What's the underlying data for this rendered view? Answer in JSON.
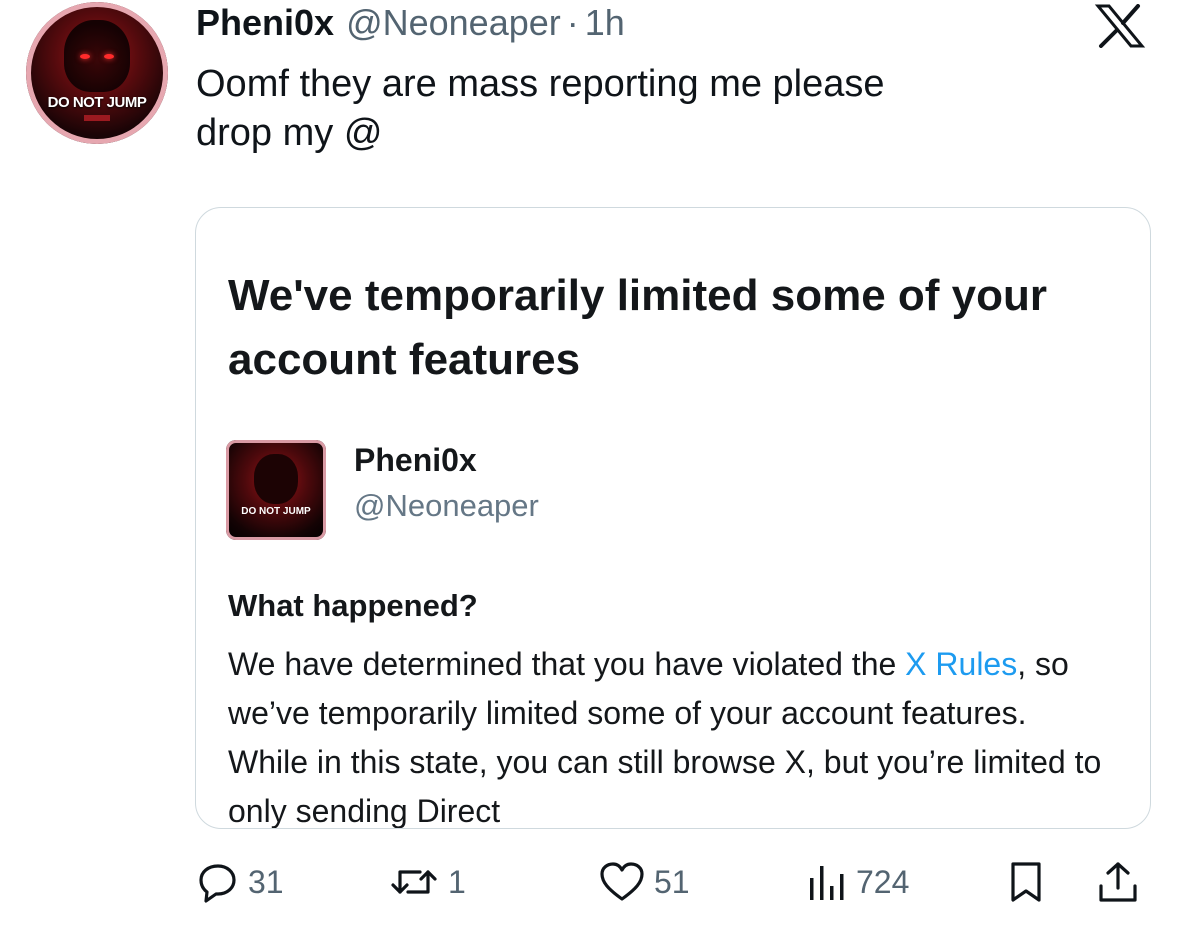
{
  "tweet": {
    "display_name": "Pheni0x",
    "handle": "@Neoneaper",
    "separator": "·",
    "time": "1h",
    "text_line1": "Oomf they are mass reporting me please",
    "text_line2": "drop my @",
    "avatar_text": "DO NOT JUMP"
  },
  "card": {
    "title": "We've temporarily limited some of your account features",
    "name": "Pheni0x",
    "handle": "@Neoneaper",
    "avatar_text": "DO NOT JUMP",
    "section_heading": "What happened?",
    "body_part1": "We have determined that you have violated the ",
    "body_link": "X Rules",
    "body_part2": ", so we’ve temporarily limited some of your account features. While in this state, you can still browse X, but you’re limited to only sending Direct"
  },
  "actions": {
    "replies": "31",
    "reposts": "1",
    "likes": "51",
    "views": "724"
  },
  "icons": {
    "logo": "x-logo-icon",
    "reply": "reply-icon",
    "repost": "repost-icon",
    "like": "heart-icon",
    "views": "views-icon",
    "bookmark": "bookmark-icon",
    "share": "share-icon"
  },
  "colors": {
    "link": "#1d9bf0",
    "secondary_text": "#536471",
    "card_border": "#cfd9de"
  }
}
